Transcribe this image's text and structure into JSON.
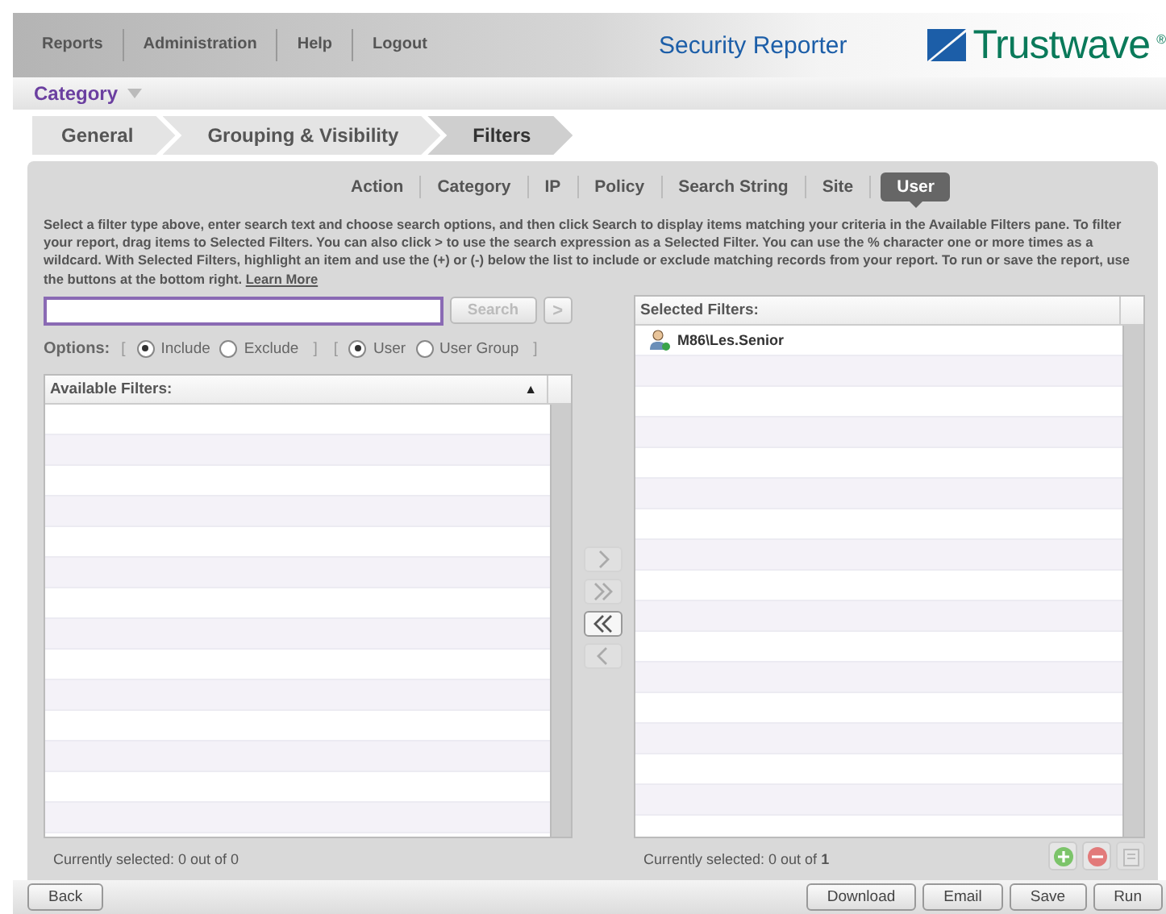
{
  "top_nav": [
    {
      "label": "Reports"
    },
    {
      "label": "Administration"
    },
    {
      "label": "Help"
    },
    {
      "label": "Logout"
    }
  ],
  "product_name": "Security Reporter",
  "logo_text": "Trustwave",
  "logo_mark": "®",
  "category_menu": {
    "label": "Category"
  },
  "steps": [
    {
      "label": "General",
      "selected": false
    },
    {
      "label": "Grouping & Visibility",
      "selected": false
    },
    {
      "label": "Filters",
      "selected": true
    }
  ],
  "filter_tabs": [
    {
      "label": "Action",
      "selected": false
    },
    {
      "label": "Category",
      "selected": false
    },
    {
      "label": "IP",
      "selected": false
    },
    {
      "label": "Policy",
      "selected": false
    },
    {
      "label": "Search String",
      "selected": false
    },
    {
      "label": "Site",
      "selected": false
    },
    {
      "label": "User",
      "selected": true
    }
  ],
  "description": "Select a filter type above, enter search text and choose search options, and then click Search to display items matching your criteria in the Available Filters pane. To filter your report, drag items to Selected Filters. You can also click > to use the search expression as a Selected Filter. You can use the % character one or more times as a wildcard. With Selected Filters, highlight an item and use the (+) or (-) below the list to include or exclude matching records from your report. To run or save the report, use the buttons at the bottom right.",
  "learn_more": "Learn More",
  "search": {
    "button": "Search",
    "disabled": true,
    "go": ">"
  },
  "options": {
    "label": "Options:",
    "groups": [
      {
        "open": "[",
        "close": "]",
        "radios": [
          {
            "label": "Include",
            "selected": true
          },
          {
            "label": "Exclude",
            "selected": false
          }
        ]
      },
      {
        "open": "[",
        "close": "]",
        "radios": [
          {
            "label": "User",
            "selected": true
          },
          {
            "label": "User Group",
            "selected": false
          }
        ]
      }
    ]
  },
  "available": {
    "header": "Available Filters:",
    "sort": "▲",
    "status": "Currently selected: 0 out of 0"
  },
  "move_buttons": [
    {
      "kind": "add",
      "disabled": true
    },
    {
      "kind": "add_all",
      "disabled": true
    },
    {
      "kind": "remove_all",
      "disabled": false
    },
    {
      "kind": "remove",
      "disabled": true
    }
  ],
  "selected": {
    "header": "Selected Filters:",
    "items": [
      {
        "label": "M86\\Les.Senior"
      }
    ],
    "status_prefix": "Currently selected: 0 out of ",
    "status_total": "1"
  },
  "item_actions": [
    {
      "kind": "include",
      "disabled": false
    },
    {
      "kind": "exclude",
      "disabled": false
    },
    {
      "kind": "properties",
      "disabled": true
    }
  ],
  "footer": {
    "left": [
      {
        "label": "Back"
      }
    ],
    "right": [
      {
        "label": "Download"
      },
      {
        "label": "Email"
      },
      {
        "label": "Save"
      },
      {
        "label": "Run"
      }
    ]
  }
}
